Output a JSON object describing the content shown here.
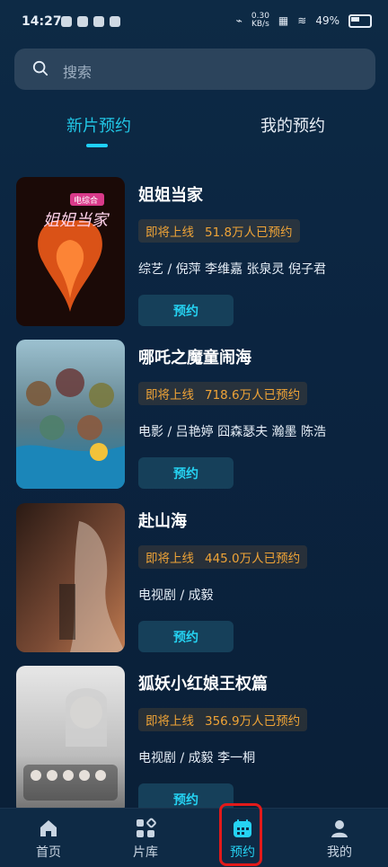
{
  "status_bar": {
    "time": "14:27",
    "network": "0.30\nKB/s",
    "battery": "49%"
  },
  "search": {
    "placeholder": "搜索"
  },
  "tabs": [
    {
      "label": "新片预约",
      "active": true
    },
    {
      "label": "我的预约",
      "active": false
    }
  ],
  "movies": [
    {
      "title": "姐姐当家",
      "status": "即将上线",
      "count": "51.8万人已预约",
      "meta": "综艺 / 倪萍 李维嘉 张泉灵 倪子君",
      "button": "预约",
      "poster_colors": [
        "#2b0f0a",
        "#f05a1a"
      ],
      "poster_text": "姐姐当家",
      "poster_tag": "电综合"
    },
    {
      "title": "哪吒之魔童闹海",
      "status": "即将上线",
      "count": "718.6万人已预约",
      "meta": "电影 / 吕艳婷 囧森瑟夫 瀚墨 陈浩",
      "button": "预约",
      "poster_colors": [
        "#3a6a7a",
        "#7cc3d6"
      ]
    },
    {
      "title": "赴山海",
      "status": "即将上线",
      "count": "445.0万人已预约",
      "meta": "电视剧 / 成毅",
      "button": "预约",
      "poster_colors": [
        "#4a2c1f",
        "#d39b73"
      ]
    },
    {
      "title": "狐妖小红娘王权篇",
      "status": "即将上线",
      "count": "356.9万人已预约",
      "meta": "电视剧 / 成毅 李一桐",
      "button": "预约",
      "poster_colors": [
        "#d9d9d9",
        "#8c8c8c"
      ]
    }
  ],
  "bottom_nav": [
    {
      "label": "首页",
      "icon": "home-icon"
    },
    {
      "label": "片库",
      "icon": "library-icon"
    },
    {
      "label": "预约",
      "icon": "calendar-icon",
      "active": true
    },
    {
      "label": "我的",
      "icon": "profile-icon"
    }
  ]
}
